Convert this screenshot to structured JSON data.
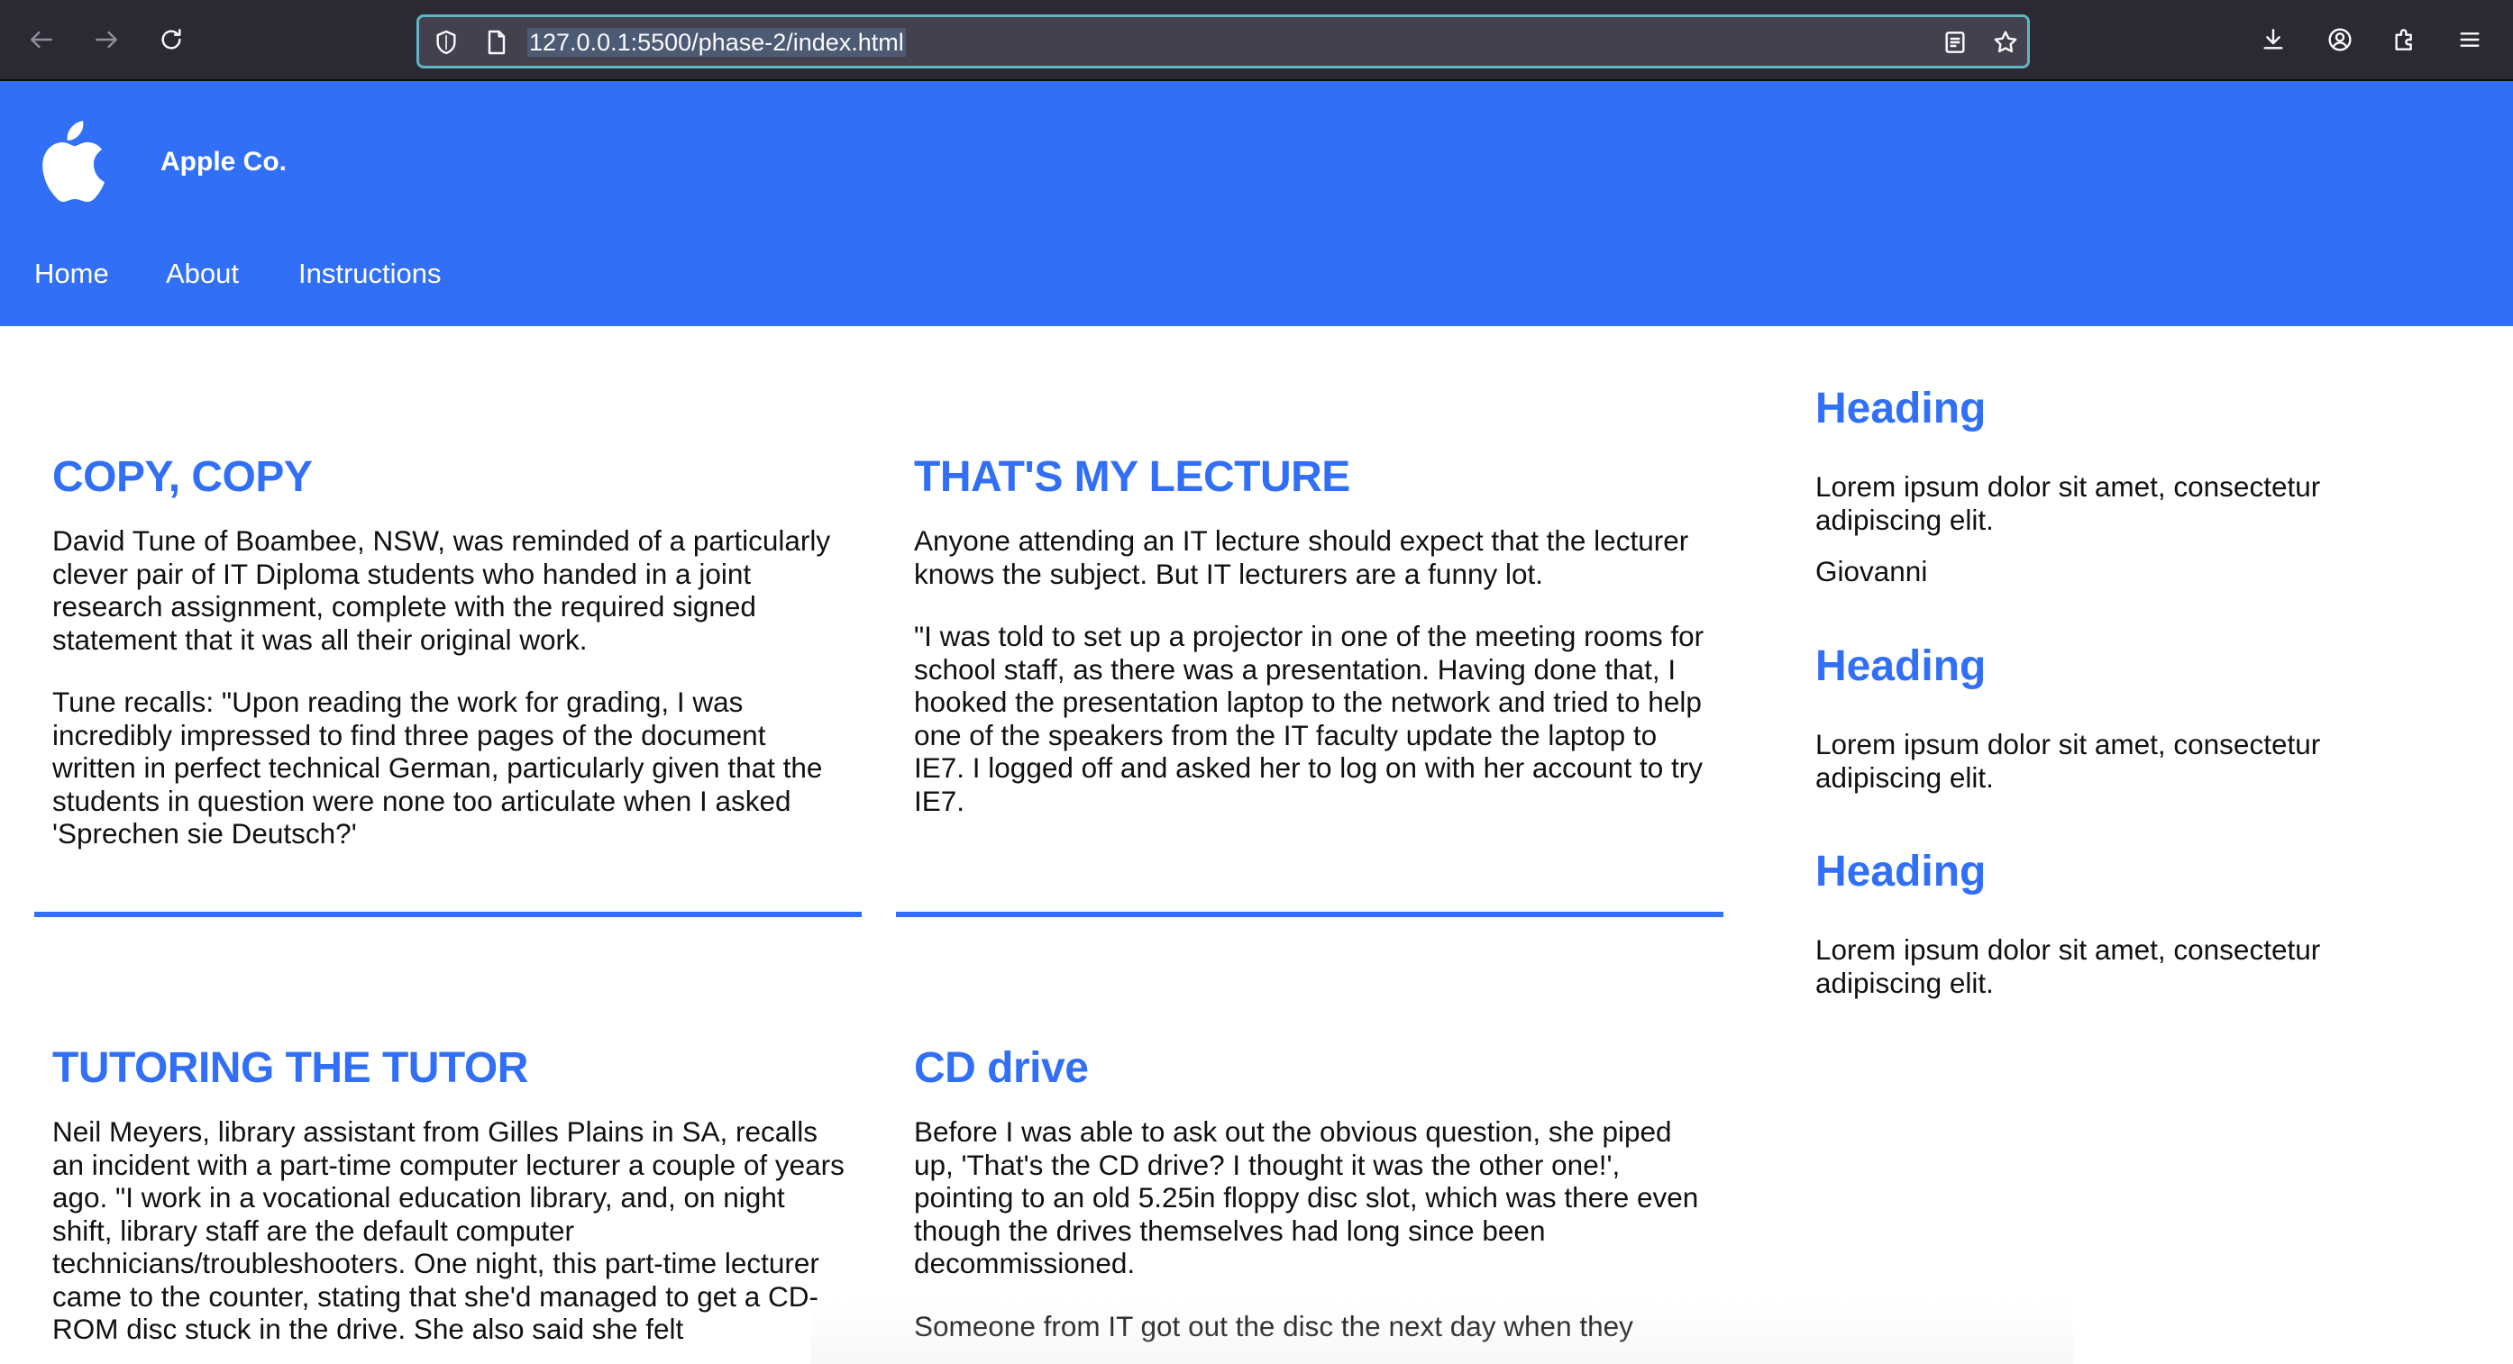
{
  "browser": {
    "url_prefix": "127.0.0.1:5500",
    "url_path": "/phase-2/index.html",
    "url_full": "127.0.0.1:5500/phase-2/index.html"
  },
  "site": {
    "brand": "Apple Co.",
    "logo_icon": "apple-logo-icon",
    "accent_color": "#316ff6",
    "nav": [
      {
        "label": "Home"
      },
      {
        "label": "About"
      },
      {
        "label": "Instructions"
      }
    ]
  },
  "articles": [
    {
      "title": "COPY, COPY",
      "paragraphs": [
        "David Tune of Boambee, NSW, was reminded of a particularly clever pair of IT Diploma students who handed in a joint research assignment, complete with the required signed statement that it was all their original work.",
        "Tune recalls: \"Upon reading the work for grading, I was incredibly impressed to find three pages of the document written in perfect technical German, particularly given that the students in question were none too articulate when I asked 'Sprechen sie Deutsch?'"
      ]
    },
    {
      "title": "THAT'S MY LECTURE",
      "paragraphs": [
        "Anyone attending an IT lecture should expect that the lecturer knows the subject. But IT lecturers are a funny lot.",
        "\"I was told to set up a projector in one of the meeting rooms for school staff, as there was a presentation. Having done that, I hooked the presentation laptop to the network and tried to help one of the speakers from the IT faculty update the laptop to IE7. I logged off and asked her to log on with her account to try IE7."
      ]
    },
    {
      "title": "TUTORING THE TUTOR",
      "paragraphs": [
        "Neil Meyers, library assistant from Gilles Plains in SA, recalls an incident with a part-time computer lecturer a couple of years ago. \"I work in a vocational education library, and, on night shift, library staff are the default computer technicians/troubleshooters. One night, this part-time lecturer came to the counter, stating that she'd managed to get a CD-ROM disc stuck in the drive. She also said she felt"
      ]
    },
    {
      "title": "CD drive",
      "paragraphs": [
        "Before I was able to ask out the obvious question, she piped up, 'That's the CD drive? I thought it was the other one!', pointing to an old 5.25in floppy disc slot, which was there even though the drives themselves had long since been decommissioned.",
        "Someone from IT got out the disc the next day when they"
      ]
    }
  ],
  "aside": [
    {
      "heading": "Heading",
      "text": "Lorem ipsum dolor sit amet, consectetur adipiscing elit.",
      "extra": "Giovanni"
    },
    {
      "heading": "Heading",
      "text": "Lorem ipsum dolor sit amet, consectetur adipiscing elit."
    },
    {
      "heading": "Heading",
      "text": "Lorem ipsum dolor sit amet, consectetur adipiscing elit."
    }
  ]
}
